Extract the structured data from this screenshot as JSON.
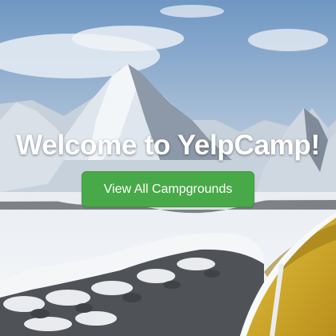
{
  "hero": {
    "title": "Welcome to YelpCamp!",
    "button_label": "View All Campgrounds"
  },
  "colors": {
    "button": "#48a948",
    "title": "#ffffff",
    "sky": "#7ea3c9",
    "snow": "#eef2f6",
    "tent": "#e0b83a"
  }
}
